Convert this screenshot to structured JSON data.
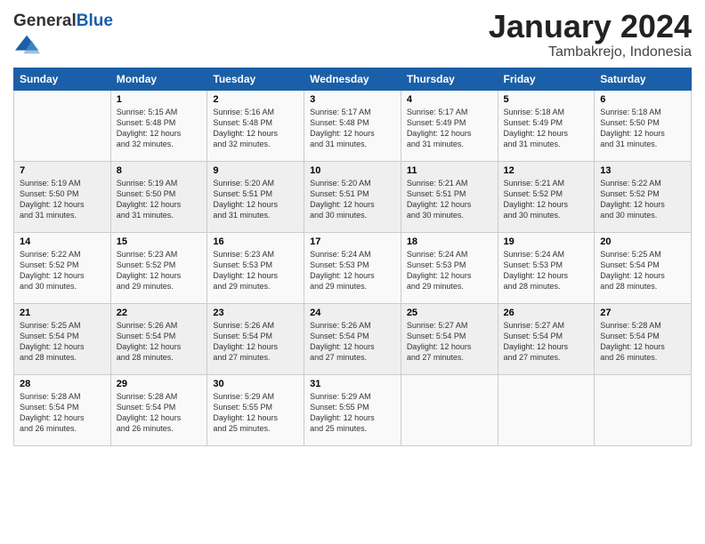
{
  "header": {
    "logo_general": "General",
    "logo_blue": "Blue",
    "month_title": "January 2024",
    "location": "Tambakrejo, Indonesia"
  },
  "days_of_week": [
    "Sunday",
    "Monday",
    "Tuesday",
    "Wednesday",
    "Thursday",
    "Friday",
    "Saturday"
  ],
  "weeks": [
    [
      {
        "day": "",
        "content": ""
      },
      {
        "day": "1",
        "content": "Sunrise: 5:15 AM\nSunset: 5:48 PM\nDaylight: 12 hours\nand 32 minutes."
      },
      {
        "day": "2",
        "content": "Sunrise: 5:16 AM\nSunset: 5:48 PM\nDaylight: 12 hours\nand 32 minutes."
      },
      {
        "day": "3",
        "content": "Sunrise: 5:17 AM\nSunset: 5:48 PM\nDaylight: 12 hours\nand 31 minutes."
      },
      {
        "day": "4",
        "content": "Sunrise: 5:17 AM\nSunset: 5:49 PM\nDaylight: 12 hours\nand 31 minutes."
      },
      {
        "day": "5",
        "content": "Sunrise: 5:18 AM\nSunset: 5:49 PM\nDaylight: 12 hours\nand 31 minutes."
      },
      {
        "day": "6",
        "content": "Sunrise: 5:18 AM\nSunset: 5:50 PM\nDaylight: 12 hours\nand 31 minutes."
      }
    ],
    [
      {
        "day": "7",
        "content": "Sunrise: 5:19 AM\nSunset: 5:50 PM\nDaylight: 12 hours\nand 31 minutes."
      },
      {
        "day": "8",
        "content": "Sunrise: 5:19 AM\nSunset: 5:50 PM\nDaylight: 12 hours\nand 31 minutes."
      },
      {
        "day": "9",
        "content": "Sunrise: 5:20 AM\nSunset: 5:51 PM\nDaylight: 12 hours\nand 31 minutes."
      },
      {
        "day": "10",
        "content": "Sunrise: 5:20 AM\nSunset: 5:51 PM\nDaylight: 12 hours\nand 30 minutes."
      },
      {
        "day": "11",
        "content": "Sunrise: 5:21 AM\nSunset: 5:51 PM\nDaylight: 12 hours\nand 30 minutes."
      },
      {
        "day": "12",
        "content": "Sunrise: 5:21 AM\nSunset: 5:52 PM\nDaylight: 12 hours\nand 30 minutes."
      },
      {
        "day": "13",
        "content": "Sunrise: 5:22 AM\nSunset: 5:52 PM\nDaylight: 12 hours\nand 30 minutes."
      }
    ],
    [
      {
        "day": "14",
        "content": "Sunrise: 5:22 AM\nSunset: 5:52 PM\nDaylight: 12 hours\nand 30 minutes."
      },
      {
        "day": "15",
        "content": "Sunrise: 5:23 AM\nSunset: 5:52 PM\nDaylight: 12 hours\nand 29 minutes."
      },
      {
        "day": "16",
        "content": "Sunrise: 5:23 AM\nSunset: 5:53 PM\nDaylight: 12 hours\nand 29 minutes."
      },
      {
        "day": "17",
        "content": "Sunrise: 5:24 AM\nSunset: 5:53 PM\nDaylight: 12 hours\nand 29 minutes."
      },
      {
        "day": "18",
        "content": "Sunrise: 5:24 AM\nSunset: 5:53 PM\nDaylight: 12 hours\nand 29 minutes."
      },
      {
        "day": "19",
        "content": "Sunrise: 5:24 AM\nSunset: 5:53 PM\nDaylight: 12 hours\nand 28 minutes."
      },
      {
        "day": "20",
        "content": "Sunrise: 5:25 AM\nSunset: 5:54 PM\nDaylight: 12 hours\nand 28 minutes."
      }
    ],
    [
      {
        "day": "21",
        "content": "Sunrise: 5:25 AM\nSunset: 5:54 PM\nDaylight: 12 hours\nand 28 minutes."
      },
      {
        "day": "22",
        "content": "Sunrise: 5:26 AM\nSunset: 5:54 PM\nDaylight: 12 hours\nand 28 minutes."
      },
      {
        "day": "23",
        "content": "Sunrise: 5:26 AM\nSunset: 5:54 PM\nDaylight: 12 hours\nand 27 minutes."
      },
      {
        "day": "24",
        "content": "Sunrise: 5:26 AM\nSunset: 5:54 PM\nDaylight: 12 hours\nand 27 minutes."
      },
      {
        "day": "25",
        "content": "Sunrise: 5:27 AM\nSunset: 5:54 PM\nDaylight: 12 hours\nand 27 minutes."
      },
      {
        "day": "26",
        "content": "Sunrise: 5:27 AM\nSunset: 5:54 PM\nDaylight: 12 hours\nand 27 minutes."
      },
      {
        "day": "27",
        "content": "Sunrise: 5:28 AM\nSunset: 5:54 PM\nDaylight: 12 hours\nand 26 minutes."
      }
    ],
    [
      {
        "day": "28",
        "content": "Sunrise: 5:28 AM\nSunset: 5:54 PM\nDaylight: 12 hours\nand 26 minutes."
      },
      {
        "day": "29",
        "content": "Sunrise: 5:28 AM\nSunset: 5:54 PM\nDaylight: 12 hours\nand 26 minutes."
      },
      {
        "day": "30",
        "content": "Sunrise: 5:29 AM\nSunset: 5:55 PM\nDaylight: 12 hours\nand 25 minutes."
      },
      {
        "day": "31",
        "content": "Sunrise: 5:29 AM\nSunset: 5:55 PM\nDaylight: 12 hours\nand 25 minutes."
      },
      {
        "day": "",
        "content": ""
      },
      {
        "day": "",
        "content": ""
      },
      {
        "day": "",
        "content": ""
      }
    ]
  ]
}
